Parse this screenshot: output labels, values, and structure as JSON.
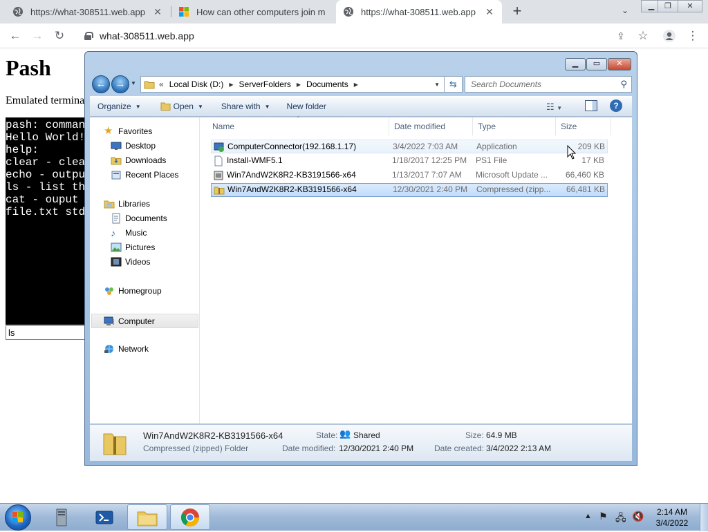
{
  "browser": {
    "tabs": [
      {
        "title": "https://what-308511.web.app",
        "active": false
      },
      {
        "title": "How can other computers join m",
        "active": false
      },
      {
        "title": "https://what-308511.web.app",
        "active": true
      }
    ],
    "url": "what-308511.web.app",
    "new_tab_label": "+"
  },
  "page": {
    "title": "Pash",
    "subtitle": "Emulated termina",
    "terminal_lines": [
      "pash: comman",
      "Hello World!",
      "help:",
      "clear - clea",
      "echo - outpu",
      "ls - list th",
      "cat - ouput ",
      "file.txt std"
    ],
    "input_value": "ls"
  },
  "explorer": {
    "breadcrumb": [
      "Local Disk (D:)",
      "ServerFolders",
      "Documents"
    ],
    "search_placeholder": "Search Documents",
    "commands": {
      "organize": "Organize",
      "open": "Open",
      "share_with": "Share with",
      "new_folder": "New folder"
    },
    "nav": {
      "favorites": "Favorites",
      "desktop": "Desktop",
      "downloads": "Downloads",
      "recent": "Recent Places",
      "libraries": "Libraries",
      "documents": "Documents",
      "music": "Music",
      "pictures": "Pictures",
      "videos": "Videos",
      "homegroup": "Homegroup",
      "computer": "Computer",
      "network": "Network"
    },
    "columns": {
      "name": "Name",
      "date": "Date modified",
      "type": "Type",
      "size": "Size"
    },
    "files": [
      {
        "name": "ComputerConnector(192.168.1.17)",
        "date": "3/4/2022 7:03 AM",
        "type": "Application",
        "size": "209 KB",
        "icon": "app-icon"
      },
      {
        "name": "Install-WMF5.1",
        "date": "1/18/2017 12:25 PM",
        "type": "PS1 File",
        "size": "17 KB",
        "icon": "ps1-file-icon"
      },
      {
        "name": "Win7AndW2K8R2-KB3191566-x64",
        "date": "1/13/2017 7:07 AM",
        "type": "Microsoft Update ...",
        "size": "66,460 KB",
        "icon": "update-package-icon"
      },
      {
        "name": "Win7AndW2K8R2-KB3191566-x64",
        "date": "12/30/2021 2:40 PM",
        "type": "Compressed (zipp...",
        "size": "66,481 KB",
        "icon": "zip-folder-icon"
      }
    ],
    "details": {
      "name": "Win7AndW2K8R2-KB3191566-x64",
      "type": "Compressed (zipped) Folder",
      "state_label": "State:",
      "state_value": "Shared",
      "modified_label": "Date modified:",
      "modified_value": "12/30/2021 2:40 PM",
      "size_label": "Size:",
      "size_value": "64.9 MB",
      "created_label": "Date created:",
      "created_value": "3/4/2022 2:13 AM"
    }
  },
  "taskbar": {
    "time": "2:14 AM",
    "date": "3/4/2022"
  }
}
